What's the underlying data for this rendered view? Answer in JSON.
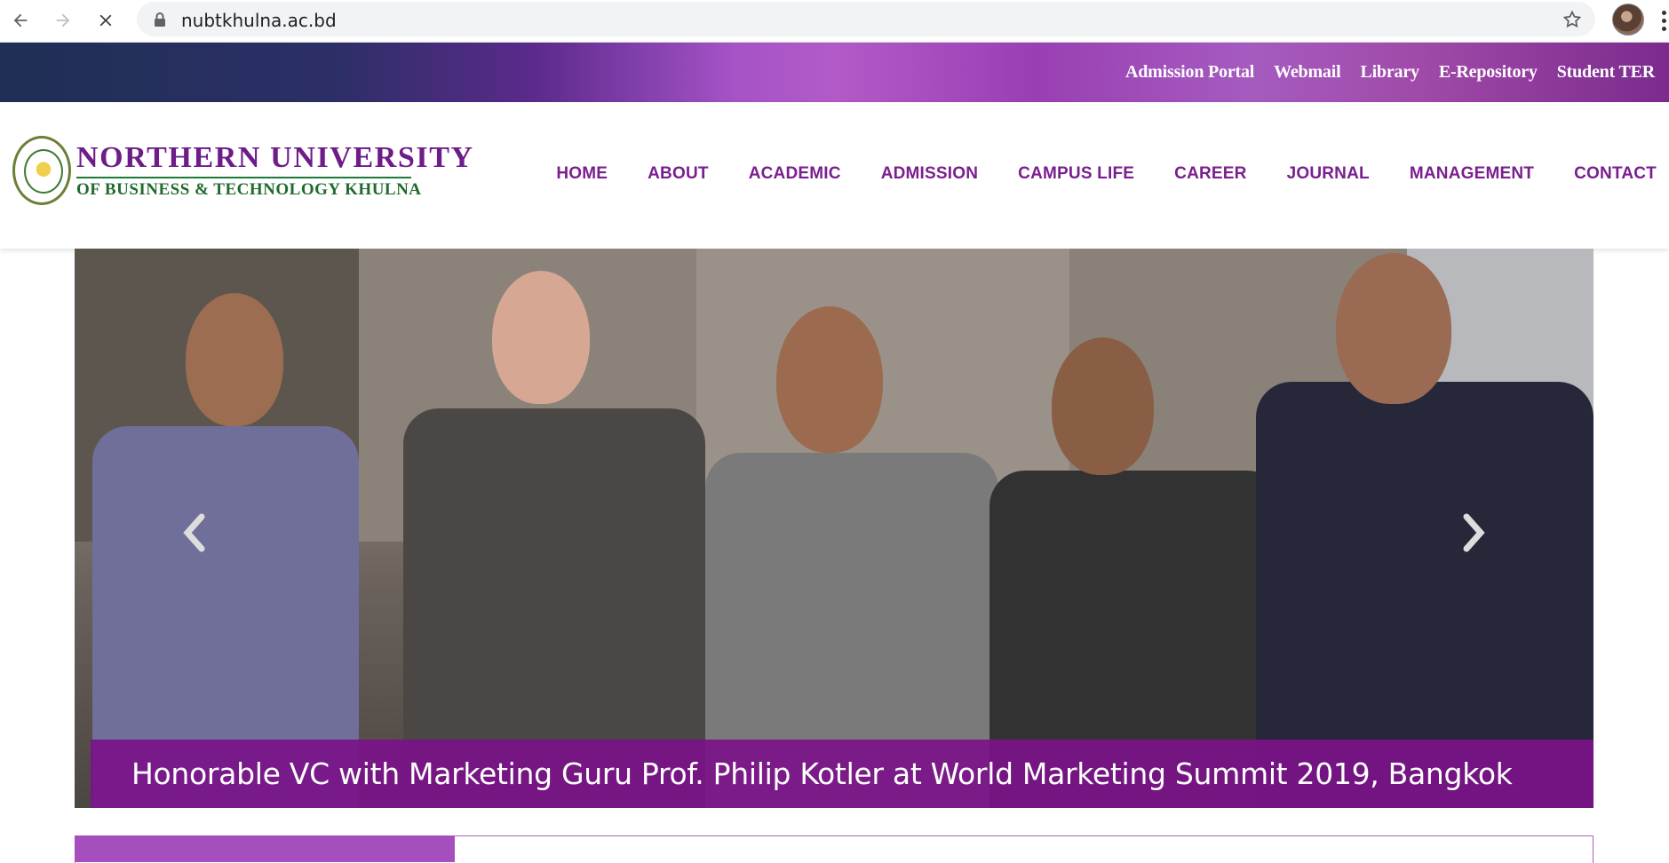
{
  "browser": {
    "url": "nubtkhulna.ac.bd",
    "back_icon": "arrow-left-icon",
    "forward_icon": "arrow-right-icon",
    "stop_icon": "close-icon",
    "bookmark_icon": "star-icon",
    "menu_icon": "kebab-menu-icon"
  },
  "topbar": {
    "links": [
      "Admission Portal",
      "Webmail",
      "Library",
      "E-Repository",
      "Student TER"
    ]
  },
  "brand": {
    "line1": "NORTHERN UNIVERSITY",
    "line2": "OF BUSINESS & TECHNOLOGY KHULNA"
  },
  "nav": {
    "items": [
      "HOME",
      "ABOUT",
      "ACADEMIC",
      "ADMISSION",
      "CAMPUS LIFE",
      "CAREER",
      "JOURNAL",
      "MANAGEMENT",
      "CONTACT"
    ]
  },
  "slider": {
    "caption": "Honorable VC with Marketing Guru Prof. Philip Kotler at World Marketing Summit 2019, Bangkok",
    "prev_icon": "chevron-left-icon",
    "next_icon": "chevron-right-icon"
  },
  "colors": {
    "brand_purple": "#7a1f8e",
    "brand_green": "#1f6b2c",
    "caption_bg": "#7a1289"
  }
}
